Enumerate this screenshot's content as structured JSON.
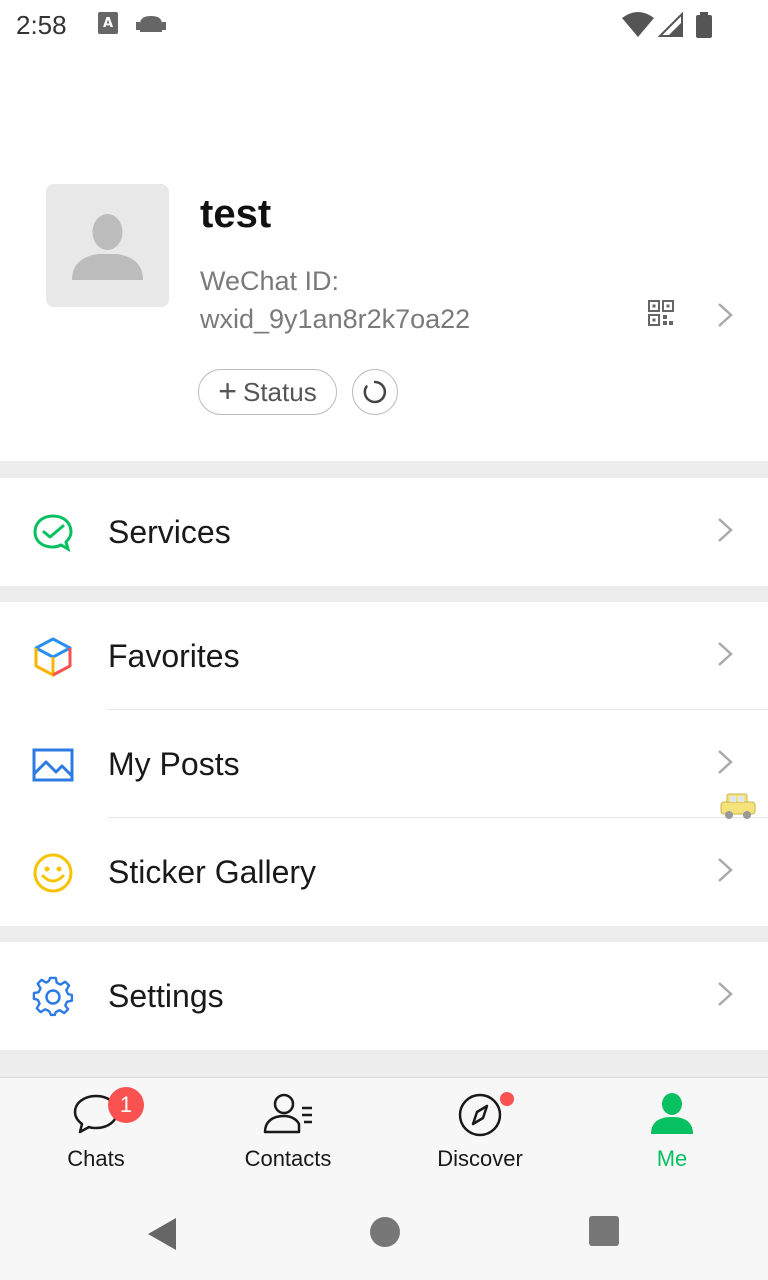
{
  "status_bar": {
    "time": "2:58"
  },
  "profile": {
    "name": "test",
    "wechat_id_label": "WeChat ID:",
    "wechat_id": "wxid_9y1an8r2k7oa22",
    "status_button_label": "Status"
  },
  "menu": {
    "services": "Services",
    "favorites": "Favorites",
    "my_posts": "My Posts",
    "sticker_gallery": "Sticker Gallery",
    "settings": "Settings"
  },
  "tabs": [
    {
      "label": "Chats",
      "badge": "1"
    },
    {
      "label": "Contacts"
    },
    {
      "label": "Discover"
    },
    {
      "label": "Me"
    }
  ],
  "colors": {
    "accent": "#07c160",
    "badge": "#fa5151"
  }
}
